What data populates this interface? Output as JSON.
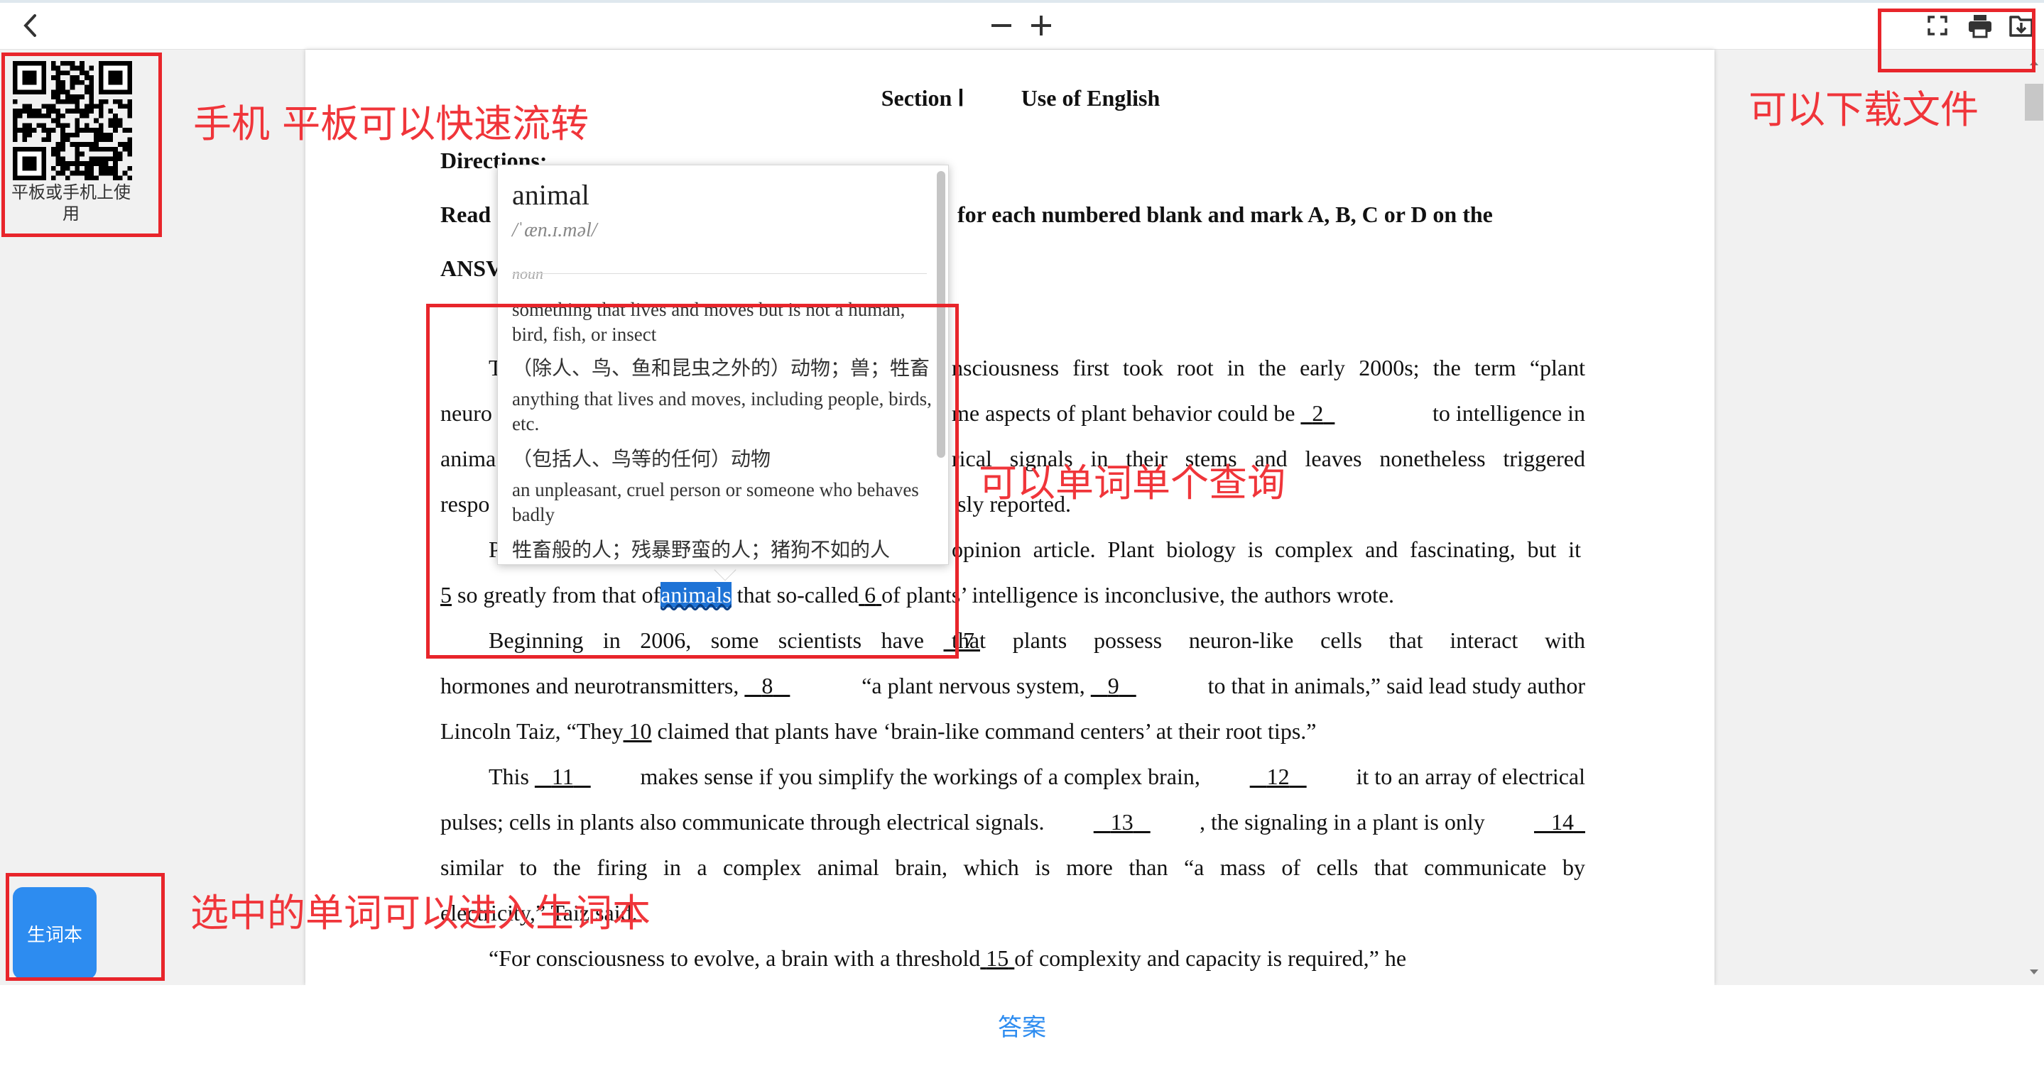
{
  "toolbar": {
    "back_icon": "chevron-left-icon",
    "zoom_out_label": "−",
    "zoom_in_label": "+",
    "fullscreen_icon": "fullscreen-icon",
    "print_icon": "printer-icon",
    "download_icon": "download-icon"
  },
  "sidebar": {
    "qr_caption": "平板或手机上使用",
    "vocab_button": "生词本"
  },
  "annotations": {
    "qr": "手机 平板可以快速流转",
    "download": "可以下载文件",
    "lookup": "可以单词单个查询",
    "vocab": "选中的单词可以进入生词本"
  },
  "popup": {
    "word": "animal",
    "phonetic": "/ˈæn.ɪ.məl/",
    "pos": "noun",
    "defs": [
      {
        "en": "something that lives and moves but is not a human, bird, fish, or insect",
        "zh": "（除人、鸟、鱼和昆虫之外的）动物；兽；牲畜"
      },
      {
        "en": "anything that lives and moves, including people, birds, etc.",
        "zh": "（包括人、鸟等的任何）动物"
      },
      {
        "en": "an unpleasant, cruel person or someone who behaves badly",
        "zh": "牲畜般的人；残暴野蛮的人；猪狗不如的人"
      }
    ]
  },
  "doc": {
    "section": "Section Ⅰ",
    "section_title": "Use of English",
    "directions_label": "Directions:",
    "dir_a": "Read",
    "dir_b": "for each numbered blank and mark A, B, C or D on the",
    "dir_c": "ANSV",
    "l1a": "T",
    "l1b": "nsciousness first took root in the early 2000s; the term “plant",
    "l2a": "neuro",
    "l2b": "me aspects of plant behavior could be",
    "l2c": "to intelligence in",
    "l3a": "anima",
    "l3b": "rical signals in their stems and leaves nonetheless triggered",
    "l4a": "respo",
    "l4b": "sly reported.",
    "l5a": "P",
    "l5b": "opinion article. Plant biology is complex and fascinating, but it",
    "l6a": "so greatly from that of",
    "l6sel": "animals",
    "l6b": "that so-called",
    "l6c": "of plants’ intelligence is inconclusive, the authors wrote.",
    "l7a": "Beginning in 2006, some scientists have",
    "l7b": "that plants possess neuron-like cells that interact with",
    "l8a": "hormones and neurotransmitters,",
    "l8b": "“a plant nervous system,",
    "l8c": "to that in animals,” said lead study author",
    "l9a": "Lincoln Taiz, “They",
    "l9b": "claimed that plants have ‘brain-like command centers’ at their root tips.”",
    "l10a": "This",
    "l10b": "makes sense if you simplify the workings of a complex brain,",
    "l10c": "it to an array of electrical",
    "l11a": "pulses; cells in plants also communicate through electrical signals.",
    "l11b": ", the signaling in a plant is only",
    "l12": "similar to the firing in a complex animal brain, which is more than “a mass of cells that communicate by",
    "l13": "electricity,” Taiz said.",
    "l14a": "“For consciousness to evolve, a brain with a threshold",
    "l14b": "of complexity and capacity is required,” he",
    "blanks": {
      "b2": "2",
      "b5": "5",
      "b6": "6",
      "b7": "7",
      "b8": "8",
      "b9": "9",
      "b10": "10",
      "b11": "11",
      "b12": "12",
      "b13": "13",
      "b14": "14",
      "b15": "15"
    }
  },
  "footer": {
    "answer_label": "答案"
  }
}
